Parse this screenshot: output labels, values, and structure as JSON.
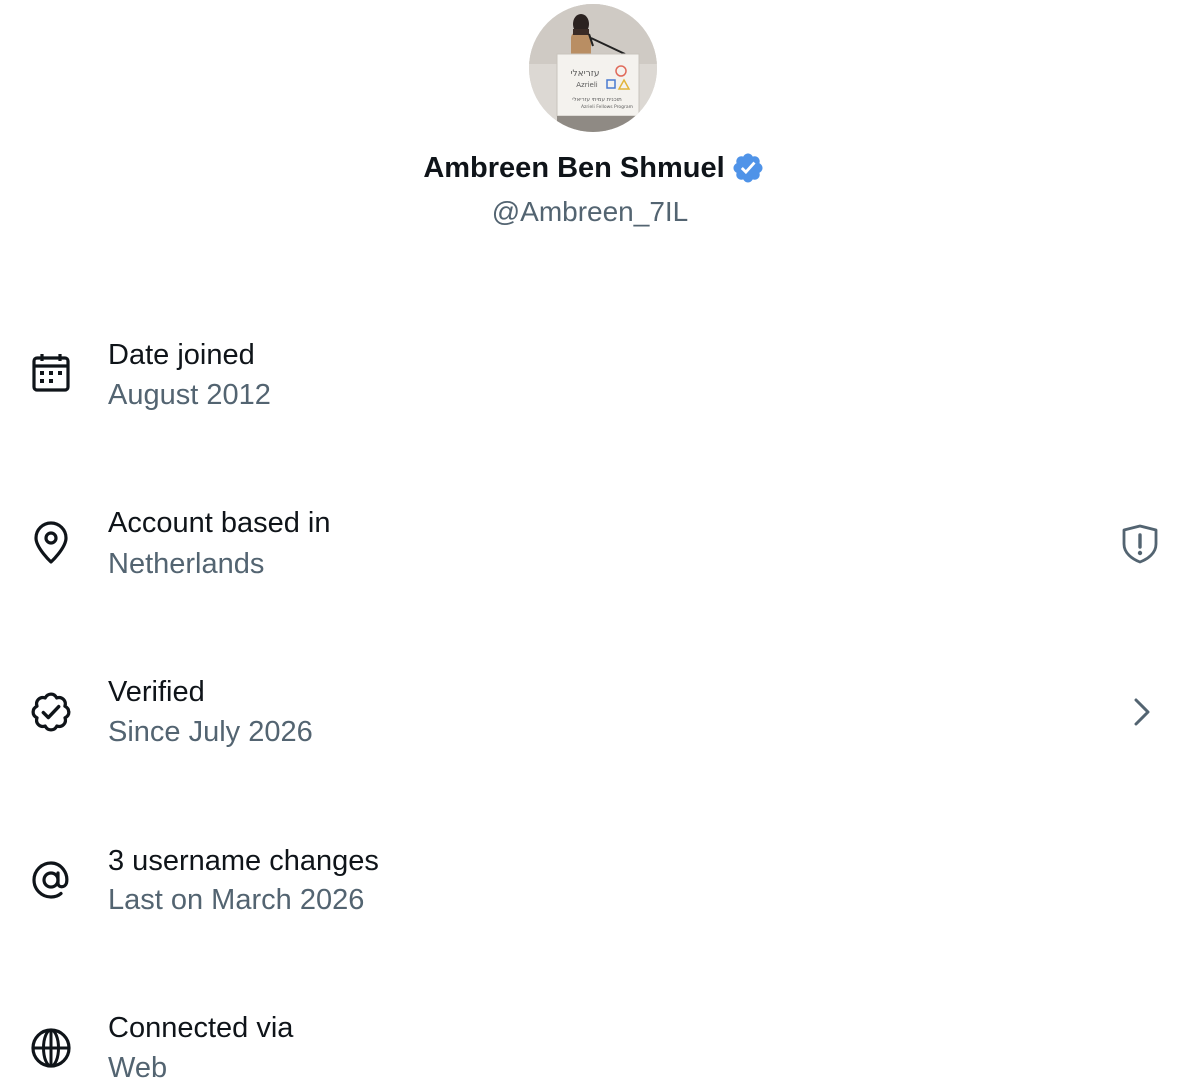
{
  "profile": {
    "display_name": "Ambreen Ben Shmuel",
    "handle": "@Ambreen_7IL",
    "avatar_sign_text": {
      "hebrew": "עזריאלי",
      "brand": "Azrieli",
      "subtitle_hebrew": "תוכנית עמיתי עזריאלי",
      "subtitle_en": "Azrieli Fellows Program"
    }
  },
  "rows": [
    {
      "title": "Date joined",
      "subtitle": "August 2012",
      "icon": "calendar-icon"
    },
    {
      "title": "Account based in",
      "subtitle": "Netherlands",
      "icon": "location-pin-icon",
      "right_icon": "shield-alert-icon"
    },
    {
      "title": "Verified",
      "subtitle": "Since July 2026",
      "icon": "verified-badge-outline-icon",
      "right_icon": "chevron-right-icon"
    },
    {
      "title": "3 username changes",
      "subtitle": "Last on March 2026",
      "icon": "at-sign-icon"
    },
    {
      "title": "Connected via",
      "subtitle": "Web",
      "icon": "globe-icon"
    }
  ],
  "colors": {
    "primary_text": "#0f1419",
    "secondary_text": "#536471",
    "verified_blue": "#1d9bf0",
    "background": "#ffffff"
  }
}
